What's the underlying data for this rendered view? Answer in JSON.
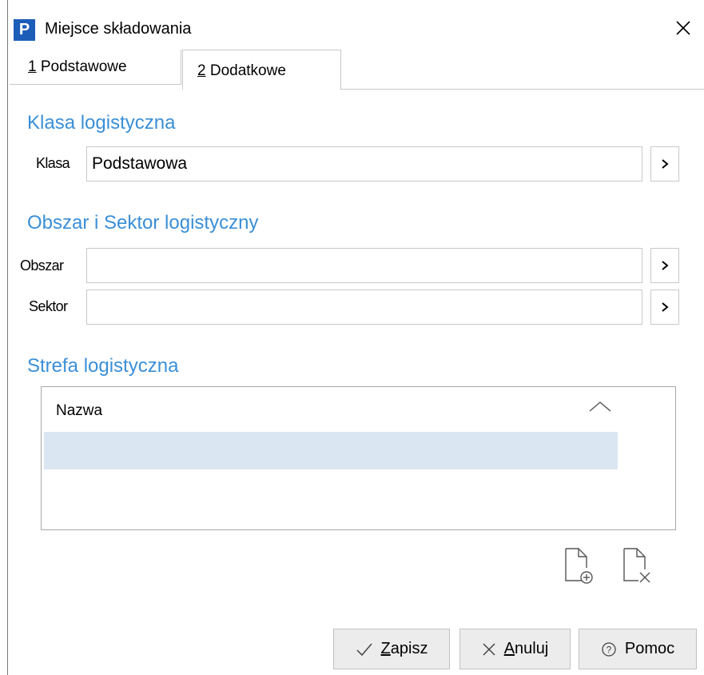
{
  "window": {
    "app_icon_letter": "P",
    "title": "Miejsce składowania"
  },
  "tabs": [
    {
      "number": "1",
      "label": " Podstawowe",
      "active": false
    },
    {
      "number": "2",
      "label": " Dodatkowe",
      "active": true
    }
  ],
  "klasa_section": {
    "heading": "Klasa logistyczna",
    "klasa": {
      "label": "Klasa",
      "value": "Podstawowa"
    }
  },
  "obszar_section": {
    "heading": "Obszar i Sektor logistyczny",
    "obszar": {
      "label": "Obszar",
      "value": ""
    },
    "sektor": {
      "label": "Sektor",
      "value": ""
    }
  },
  "strefa_section": {
    "heading": "Strefa logistyczna",
    "columns": [
      "Nazwa"
    ],
    "rows": [
      {
        "nazwa": ""
      }
    ]
  },
  "footer": {
    "save": {
      "mnemonic": "Z",
      "rest": "apisz"
    },
    "cancel": {
      "mnemonic": "A",
      "rest": "nuluj"
    },
    "help": {
      "label": "Pomoc"
    }
  },
  "colors": {
    "accent": "#3a8fd6",
    "app_icon": "#1c5db8",
    "selected_row": "#dbe6f3",
    "button_bg": "#ececec"
  },
  "icons": [
    "app-icon",
    "close-icon",
    "chevron-right-icon",
    "sort-ascending-icon",
    "add-document-icon",
    "delete-document-icon",
    "check-icon",
    "x-icon",
    "help-circle-icon"
  ]
}
